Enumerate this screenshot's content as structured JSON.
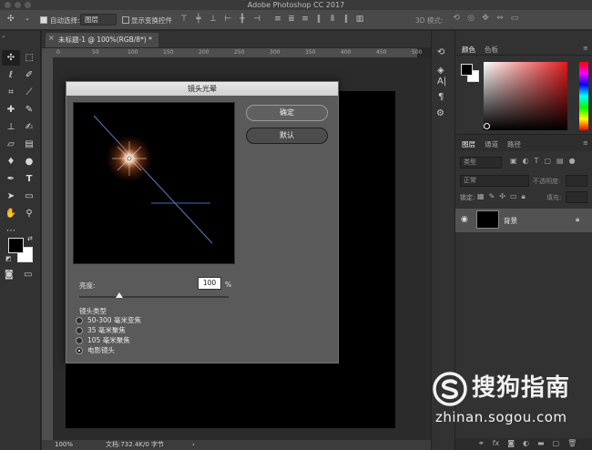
{
  "app": {
    "title": "Adobe Photoshop CC 2017"
  },
  "options_bar": {
    "auto_select_label": "自动选择:",
    "layer_select_value": "图层",
    "show_transform_label": "显示变换控件",
    "mode3d_label": "3D 模式:"
  },
  "document": {
    "tab_title": "未标题-1 @ 100%(RGB/8*) *",
    "ruler_ticks": [
      "0",
      "50",
      "100",
      "150",
      "200",
      "250",
      "300",
      "350",
      "400",
      "450",
      "500"
    ]
  },
  "status": {
    "zoom": "100%",
    "doc_info": "文档:732.4K/0 字节"
  },
  "dialog": {
    "title": "镜头光晕",
    "ok_label": "确定",
    "default_label": "默认",
    "brightness_label": "亮度:",
    "brightness_value": "100",
    "percent": "%",
    "brightness_fraction": 0.27,
    "lens_type_label": "镜头类型",
    "lens_options": [
      {
        "label": "50-300 毫米变焦",
        "selected": false
      },
      {
        "label": "35 毫米聚焦",
        "selected": false
      },
      {
        "label": "105 毫米聚焦",
        "selected": false
      },
      {
        "label": "电影镜头",
        "selected": true
      }
    ]
  },
  "panels": {
    "color_tab": "颜色",
    "swatches_tab": "色板",
    "layers_tab": "图层",
    "channels_tab": "通道",
    "paths_tab": "路径",
    "kind_filter": "类型",
    "blend_mode": "正常",
    "opacity_label": "不透明度:",
    "lock_label": "锁定:",
    "fill_label": "填充:",
    "layer_name": "背景"
  },
  "watermark": {
    "name": "搜狗指南",
    "url": "zhinan.sogou.com"
  },
  "colors": {
    "foreground": "#000000",
    "background": "#ffffff",
    "accent_red": "#e11b1b"
  }
}
